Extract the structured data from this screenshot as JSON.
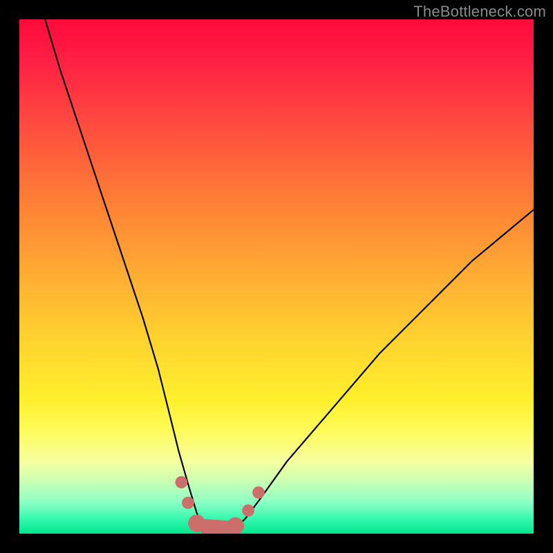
{
  "watermark": "TheBottleneck.com",
  "colors": {
    "frame": "#000000",
    "curve": "#000000",
    "marker": "#cc6f6c",
    "watermark": "#8a8a8a"
  },
  "chart_data": {
    "type": "line",
    "title": "",
    "xlabel": "",
    "ylabel": "",
    "xlim": [
      0,
      100
    ],
    "ylim": [
      0,
      100
    ],
    "grid": false,
    "legend": false,
    "series": [
      {
        "name": "bottleneck-curve",
        "x": [
          5,
          8,
          12,
          16,
          20,
          24,
          27,
          29,
          31,
          33,
          34.5,
          36,
          38,
          40,
          42,
          44,
          47,
          52,
          58,
          64,
          70,
          76,
          82,
          88,
          94,
          100
        ],
        "y": [
          100,
          90,
          78,
          66,
          54,
          42,
          32,
          24,
          16,
          9,
          4,
          1,
          0,
          0,
          1,
          3,
          7,
          14,
          21,
          28,
          35,
          41,
          47,
          53,
          58,
          63
        ]
      }
    ],
    "markers": [
      {
        "x": 31.5,
        "y": 10,
        "r": 1.2
      },
      {
        "x": 32.8,
        "y": 6,
        "r": 1.2
      },
      {
        "x": 34.5,
        "y": 2,
        "r": 1.7
      },
      {
        "x": 37,
        "y": 0.5,
        "r": 1.7
      },
      {
        "x": 39.5,
        "y": 0.5,
        "r": 1.7
      },
      {
        "x": 42,
        "y": 1.5,
        "r": 1.7
      },
      {
        "x": 44.5,
        "y": 4.5,
        "r": 1.2
      },
      {
        "x": 46.5,
        "y": 8,
        "r": 1.2
      }
    ],
    "marker_connector": [
      {
        "x": 34.5,
        "y": 2
      },
      {
        "x": 42,
        "y": 1.5
      }
    ]
  }
}
